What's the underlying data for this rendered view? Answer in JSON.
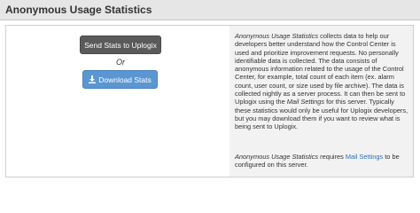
{
  "header": {
    "title": "Anonymous Usage Statistics"
  },
  "actions": {
    "send_label": "Send Stats to Uplogix",
    "or_label": "Or",
    "download_label": "Download Stats",
    "download_icon": "download-icon"
  },
  "description": {
    "term": "Anonymous Usage Statistics",
    "body_1": " collects data to help our developers better understand how the Control Center is used and prioritize improvement requests. No personally identifiable data is collected. The data consists of anonymous information related to the usage of the Control Center, for example, total count of each item (ex. alarm count, user count, or size used by file archive). The data is collected nightly as a server process. It can then be sent to Uplogix using the ",
    "mail_settings_em": "Mail Settings",
    "body_2": " for this server. Typically these statistics would only be useful for Uplogix developers, but you may download them if you want to review what is being sent to Uplogix."
  },
  "requirement": {
    "term": "Anonymous Usage Statistics",
    "text_1": " requires ",
    "link_label": "Mail Settings",
    "text_2": " to be configured on this server."
  },
  "colors": {
    "header_bg": "#e6e6e6",
    "send_button_bg": "#5a5a5a",
    "download_button_bg": "#5a96d2",
    "link": "#2a6fb8",
    "info_panel_bg": "#f2f2f2"
  }
}
